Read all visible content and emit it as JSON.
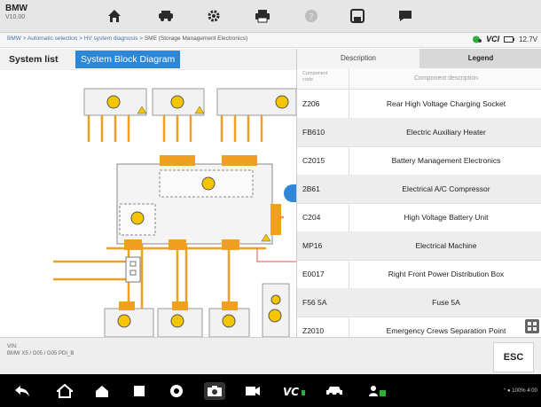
{
  "app": {
    "brand": "BMW",
    "version": "V10.00"
  },
  "toolbar": {
    "icons": [
      "home-icon",
      "vehicle-icon",
      "settings-icon",
      "print-icon",
      "help-icon",
      "save-icon",
      "chat-icon"
    ]
  },
  "breadcrumb": {
    "path": "BMW > Automatic selection > HV system diagnosis > ",
    "current": "SME (Storage Management Electronics)"
  },
  "status": {
    "vci_label": "VCI",
    "battery": "12.7V"
  },
  "tabs": {
    "system_list": "System list",
    "block_diagram": "System Block Diagram"
  },
  "panel": {
    "tab_description": "Description",
    "tab_legend": "Legend",
    "col_code": "Component code",
    "col_desc": "Component description",
    "rows": [
      {
        "code": "Z206",
        "name": "Rear High Voltage Charging Socket"
      },
      {
        "code": "FB610",
        "name": "Electric Auxiliary Heater"
      },
      {
        "code": "C2015",
        "name": "Battery Management Electronics"
      },
      {
        "code": "2B61",
        "name": "Electrical A/C Compressor"
      },
      {
        "code": "C204",
        "name": "High Voltage Battery Unit"
      },
      {
        "code": "MP16",
        "name": "Electrical Machine"
      },
      {
        "code": "E0017",
        "name": "Right Front Power Distribution Box"
      },
      {
        "code": "F56 5A",
        "name": "Fuse 5A"
      },
      {
        "code": "Z2010",
        "name": "Emergency Crews Separation Point"
      }
    ]
  },
  "footer": {
    "vin_label": "VIN:",
    "vin_value": "BMW X5 / G05 / G05 PDI_B",
    "esc_label": "ESC"
  },
  "system_status": "° ● 100% 4:00",
  "colors": {
    "accent": "#2e86d6",
    "wire": "#f0a020",
    "component": "#f7c400"
  }
}
